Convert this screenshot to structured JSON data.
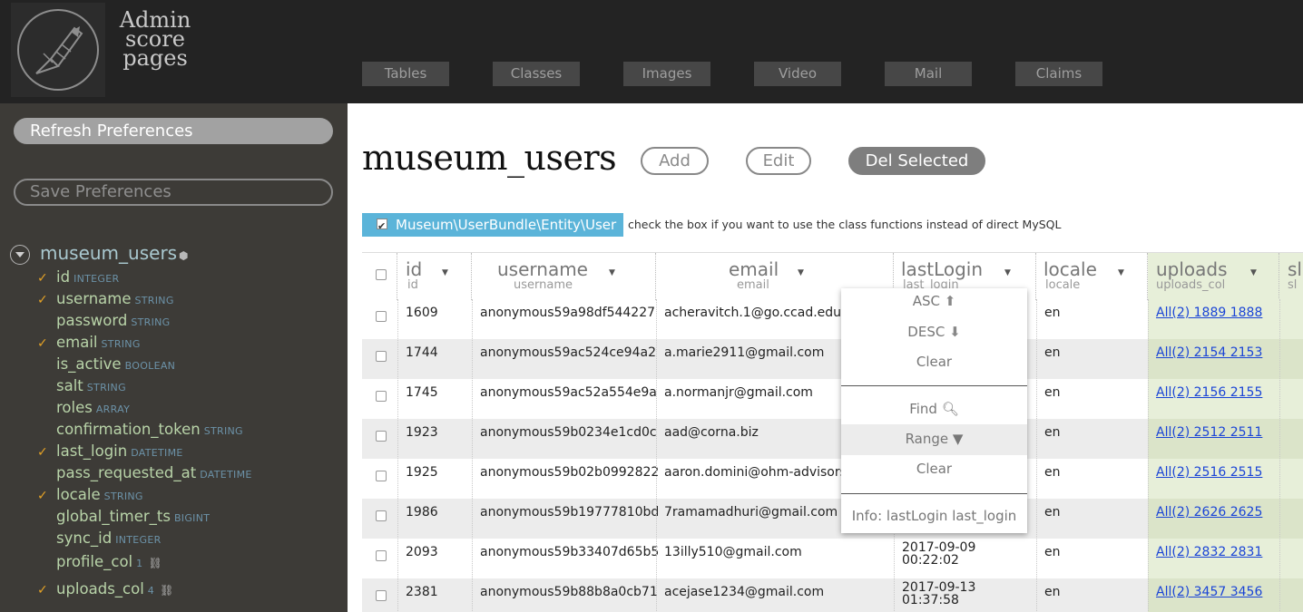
{
  "app": {
    "logo_lines": [
      "Admin",
      "score",
      "pages"
    ]
  },
  "nav": [
    "Tables",
    "Classes",
    "Images",
    "Video",
    "Mail",
    "Claims"
  ],
  "sidebar": {
    "refresh_label": "Refresh Preferences",
    "save_label": "Save Preferences",
    "entity": "museum_users",
    "fields": [
      {
        "name": "id",
        "type": "INTEGER",
        "checked": true
      },
      {
        "name": "username",
        "type": "STRING",
        "checked": true
      },
      {
        "name": "password",
        "type": "STRING",
        "checked": false
      },
      {
        "name": "email",
        "type": "STRING",
        "checked": true
      },
      {
        "name": "is_active",
        "type": "BOOLEAN",
        "checked": false
      },
      {
        "name": "salt",
        "type": "STRING",
        "checked": false
      },
      {
        "name": "roles",
        "type": "ARRAY",
        "checked": false
      },
      {
        "name": "confirmation_token",
        "type": "STRING",
        "checked": false
      },
      {
        "name": "last_login",
        "type": "DATETIME",
        "checked": true
      },
      {
        "name": "pass_requested_at",
        "type": "DATETIME",
        "checked": false
      },
      {
        "name": "locale",
        "type": "STRING",
        "checked": true
      },
      {
        "name": "global_timer_ts",
        "type": "BIGINT",
        "checked": false
      },
      {
        "name": "sync_id",
        "type": "INTEGER",
        "checked": false
      },
      {
        "name": "profile_col",
        "type": "1",
        "checked": false
      },
      {
        "name": "uploads_col",
        "type": "4",
        "checked": true
      }
    ],
    "checkmark": "✓"
  },
  "main": {
    "title": "museum_users",
    "add_label": "Add",
    "edit_label": "Edit",
    "del_label": "Del Selected",
    "class_name": "Museum\\UserBundle\\Entity\\User",
    "class_hint": "check the box if you want to use the class functions instead of direct MySQL"
  },
  "table": {
    "columns": [
      {
        "title": "id",
        "sub": "id"
      },
      {
        "title": "username",
        "sub": "username"
      },
      {
        "title": "email",
        "sub": "email"
      },
      {
        "title": "lastLogin",
        "sub": "last_login"
      },
      {
        "title": "locale",
        "sub": "locale"
      },
      {
        "title": "uploads",
        "sub": "uploads_col"
      },
      {
        "title": "sl",
        "sub": "sl"
      }
    ],
    "rows": [
      {
        "id": "1609",
        "username": "anonymous59a98df544227",
        "email": "acheravitch.1@go.ccad.edu",
        "last_login": [
          "",
          ""
        ],
        "locale": "en",
        "uploads": "All(2) 1889 1888"
      },
      {
        "id": "1744",
        "username": "anonymous59ac524ce94a2",
        "email": "a.marie2911@gmail.com",
        "last_login": [
          "",
          ""
        ],
        "locale": "en",
        "uploads": "All(2) 2154 2153"
      },
      {
        "id": "1745",
        "username": "anonymous59ac52a554e9a",
        "email": "a.normanjr@gmail.com",
        "last_login": [
          "",
          ""
        ],
        "locale": "en",
        "uploads": "All(2) 2156 2155"
      },
      {
        "id": "1923",
        "username": "anonymous59b0234e1cd0c",
        "email": "aad@corna.biz",
        "last_login": [
          "",
          ""
        ],
        "locale": "en",
        "uploads": "All(2) 2512 2511"
      },
      {
        "id": "1925",
        "username": "anonymous59b02b0992822",
        "email": "aaron.domini@ohm-advisors.c",
        "last_login": [
          "",
          ""
        ],
        "locale": "en",
        "uploads": "All(2) 2516 2515"
      },
      {
        "id": "1986",
        "username": "anonymous59b19777810bd",
        "email": "7ramamadhuri@gmail.com",
        "last_login": [
          "",
          ""
        ],
        "locale": "en",
        "uploads": "All(2) 2626 2625"
      },
      {
        "id": "2093",
        "username": "anonymous59b33407d65b5",
        "email": "13illy510@gmail.com",
        "last_login": [
          "2017-09-09",
          "00:22:02"
        ],
        "locale": "en",
        "uploads": "All(2) 2832 2831"
      },
      {
        "id": "2381",
        "username": "anonymous59b88b8a0cb71",
        "email": "acejase1234@gmail.com",
        "last_login": [
          "2017-09-13",
          "01:37:58"
        ],
        "locale": "en",
        "uploads": "All(2) 3457 3456"
      }
    ]
  },
  "popup": {
    "asc": "ASC",
    "desc": "DESC",
    "clear1": "Clear",
    "find": "Find",
    "range": "Range",
    "clear2": "Clear",
    "info": "Info: lastLogin last_login"
  },
  "icons": {
    "asc": "arrow-up-circle-icon",
    "desc": "arrow-down-circle-icon",
    "find": "search-icon",
    "range": "filter-icon",
    "sort": "caret-down-icon"
  }
}
